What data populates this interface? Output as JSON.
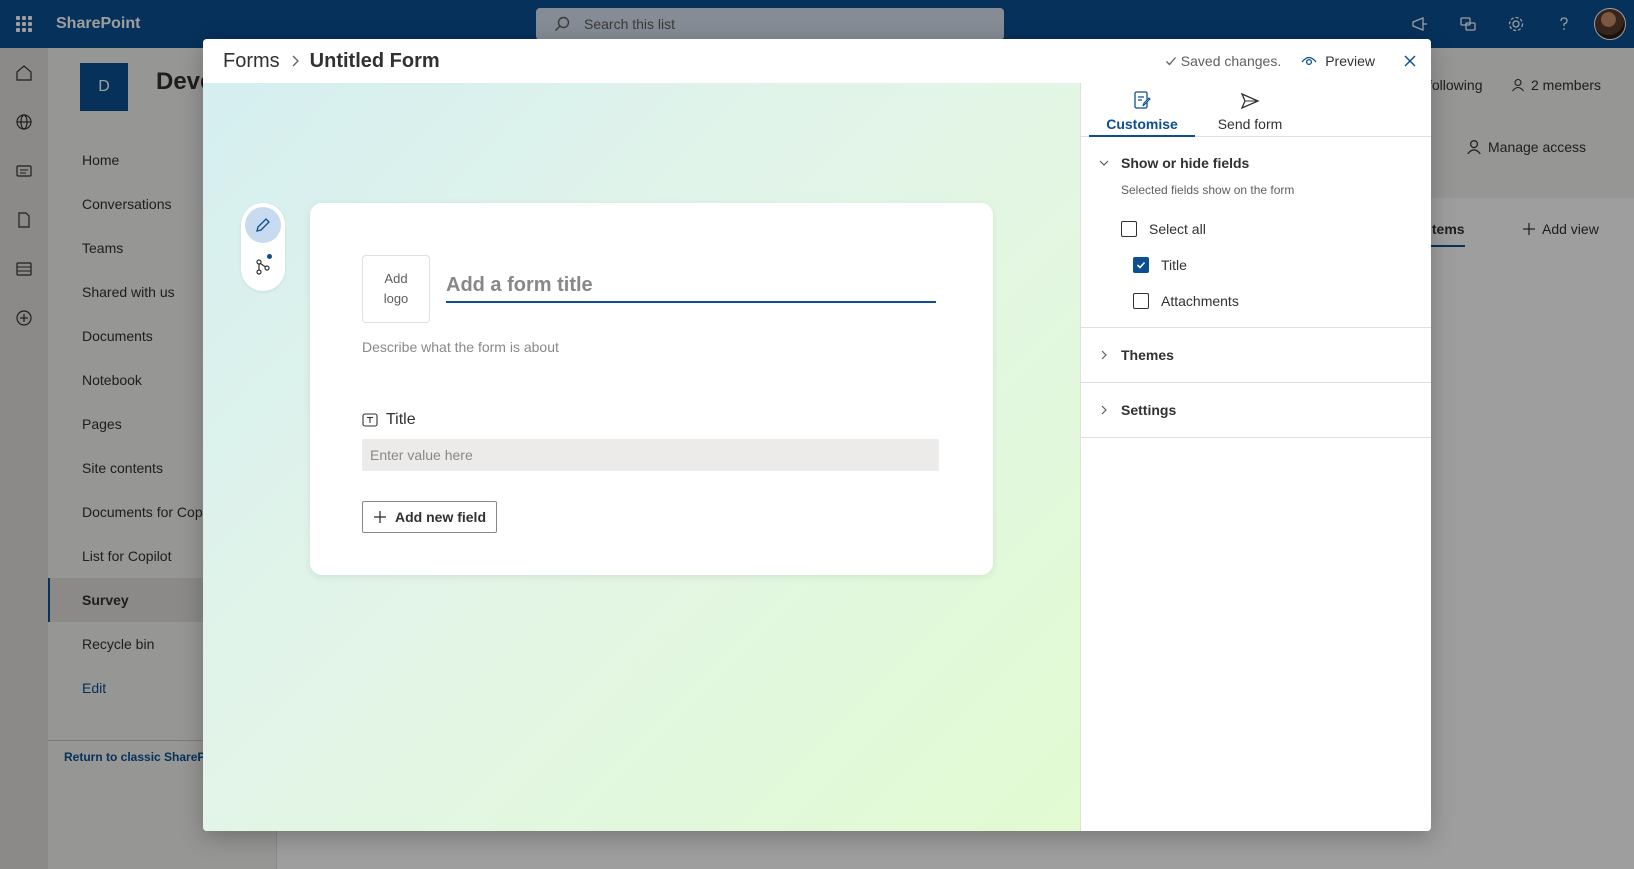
{
  "suite": {
    "app_name": "SharePoint",
    "search_placeholder": "Search this list"
  },
  "site": {
    "logo_letter": "D",
    "title": "Deve",
    "following": "following",
    "members": "2 members",
    "manage_access": "Manage access",
    "items_tab": "Items",
    "add_view": "Add view",
    "nav": [
      {
        "label": "Home"
      },
      {
        "label": "Conversations"
      },
      {
        "label": "Teams"
      },
      {
        "label": "Shared with us"
      },
      {
        "label": "Documents"
      },
      {
        "label": "Notebook"
      },
      {
        "label": "Pages"
      },
      {
        "label": "Site contents"
      },
      {
        "label": "Documents for Cop"
      },
      {
        "label": "List for Copilot"
      },
      {
        "label": "Survey"
      },
      {
        "label": "Recycle bin"
      },
      {
        "label": "Edit"
      }
    ],
    "classic_link": "Return to classic SharePoi"
  },
  "dialog": {
    "breadcrumb": [
      "Forms",
      "Untitled Form"
    ],
    "saved_status": "Saved changes.",
    "preview_label": "Preview",
    "form": {
      "add_logo_line1": "Add",
      "add_logo_line2": "logo",
      "title_placeholder": "Add a form title",
      "description_placeholder": "Describe what the form is about",
      "field_label": "Title",
      "field_placeholder": "Enter value here",
      "add_field_label": "Add new field"
    },
    "panel": {
      "tabs": [
        {
          "label": "Customise",
          "active": true
        },
        {
          "label": "Send form",
          "active": false
        }
      ],
      "show_hide": {
        "label": "Show or hide fields",
        "sub": "Selected fields show on the form",
        "select_all": "Select all",
        "fields": [
          {
            "label": "Title",
            "checked": true
          },
          {
            "label": "Attachments",
            "checked": false
          }
        ]
      },
      "themes_label": "Themes",
      "settings_label": "Settings"
    }
  },
  "colors": {
    "brand": "#0b4f91",
    "canvas_start": "#d5eef0",
    "canvas_end": "#e2fbd2"
  }
}
